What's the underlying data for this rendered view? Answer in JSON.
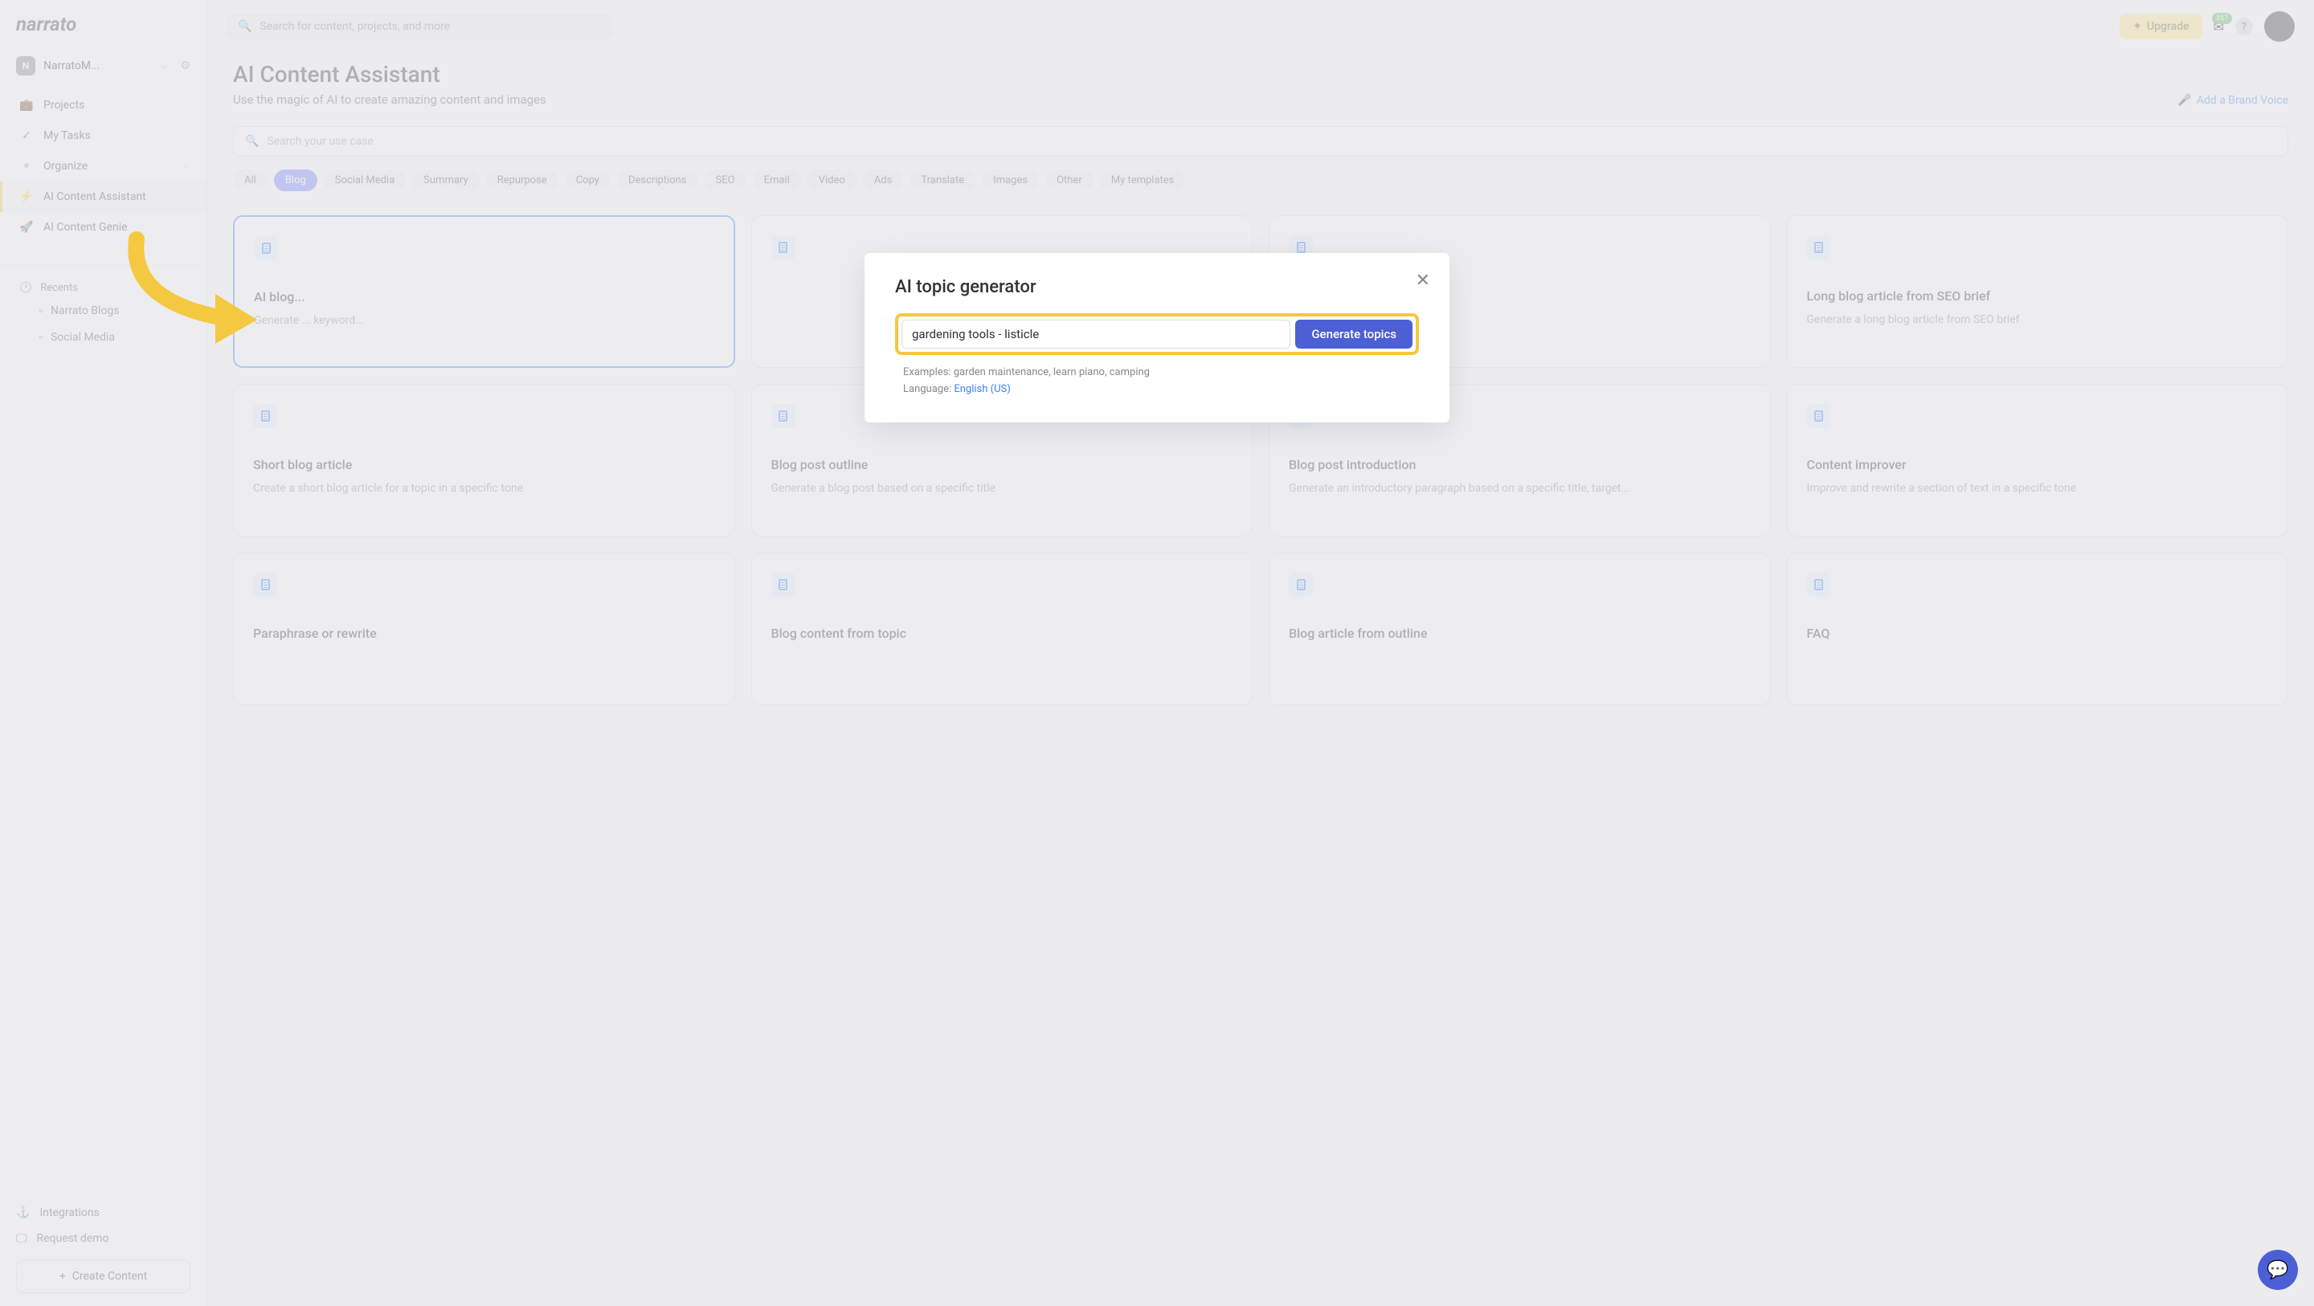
{
  "logo": "narrato",
  "workspace": {
    "badge": "N",
    "name": "NarratoM..."
  },
  "nav": {
    "projects": "Projects",
    "tasks": "My Tasks",
    "organize": "Organize",
    "assistant": "AI Content Assistant",
    "genie": "AI Content Genie"
  },
  "recents": {
    "header": "Recents",
    "items": [
      "Narrato Blogs",
      "Social Media"
    ]
  },
  "bottom": {
    "integrations": "Integrations",
    "demo": "Request demo",
    "create": "Create Content"
  },
  "topbar": {
    "search_placeholder": "Search for content, projects, and more",
    "upgrade": "Upgrade",
    "notif_count": "357"
  },
  "page": {
    "title": "AI Content Assistant",
    "subtitle": "Use the magic of AI to create amazing content and images",
    "brand_voice": "Add a Brand Voice",
    "usecase_placeholder": "Search your use case"
  },
  "chips": [
    "All",
    "Blog",
    "Social Media",
    "Summary",
    "Repurpose",
    "Copy",
    "Descriptions",
    "SEO",
    "Email",
    "Video",
    "Ads",
    "Translate",
    "Images",
    "Other",
    "My templates"
  ],
  "active_chip": "Blog",
  "cards": [
    {
      "title": "AI blog...",
      "desc": "Generate ... keyword..."
    },
    {
      "title": "",
      "desc": ""
    },
    {
      "title": "",
      "desc": ""
    },
    {
      "title": "Long blog article from SEO brief",
      "desc": "Generate a long blog article from SEO brief"
    },
    {
      "title": "Short blog article",
      "desc": "Create a short blog article for a topic in a specific tone"
    },
    {
      "title": "Blog post outline",
      "desc": "Generate a blog post based on a specific title"
    },
    {
      "title": "Blog post introduction",
      "desc": "Generate an introductory paragraph based on a specific title, target..."
    },
    {
      "title": "Content improver",
      "desc": "Improve and rewrite a section of text in a specific tone"
    },
    {
      "title": "Paraphrase or rewrite",
      "desc": ""
    },
    {
      "title": "Blog content from topic",
      "desc": ""
    },
    {
      "title": "Blog article from outline",
      "desc": ""
    },
    {
      "title": "FAQ",
      "desc": ""
    }
  ],
  "modal": {
    "title": "AI topic generator",
    "input_value": "gardening tools - listicle",
    "button": "Generate topics",
    "examples": "Examples: garden maintenance, learn piano, camping",
    "lang_label": "Language: ",
    "lang_value": "English (US)"
  }
}
